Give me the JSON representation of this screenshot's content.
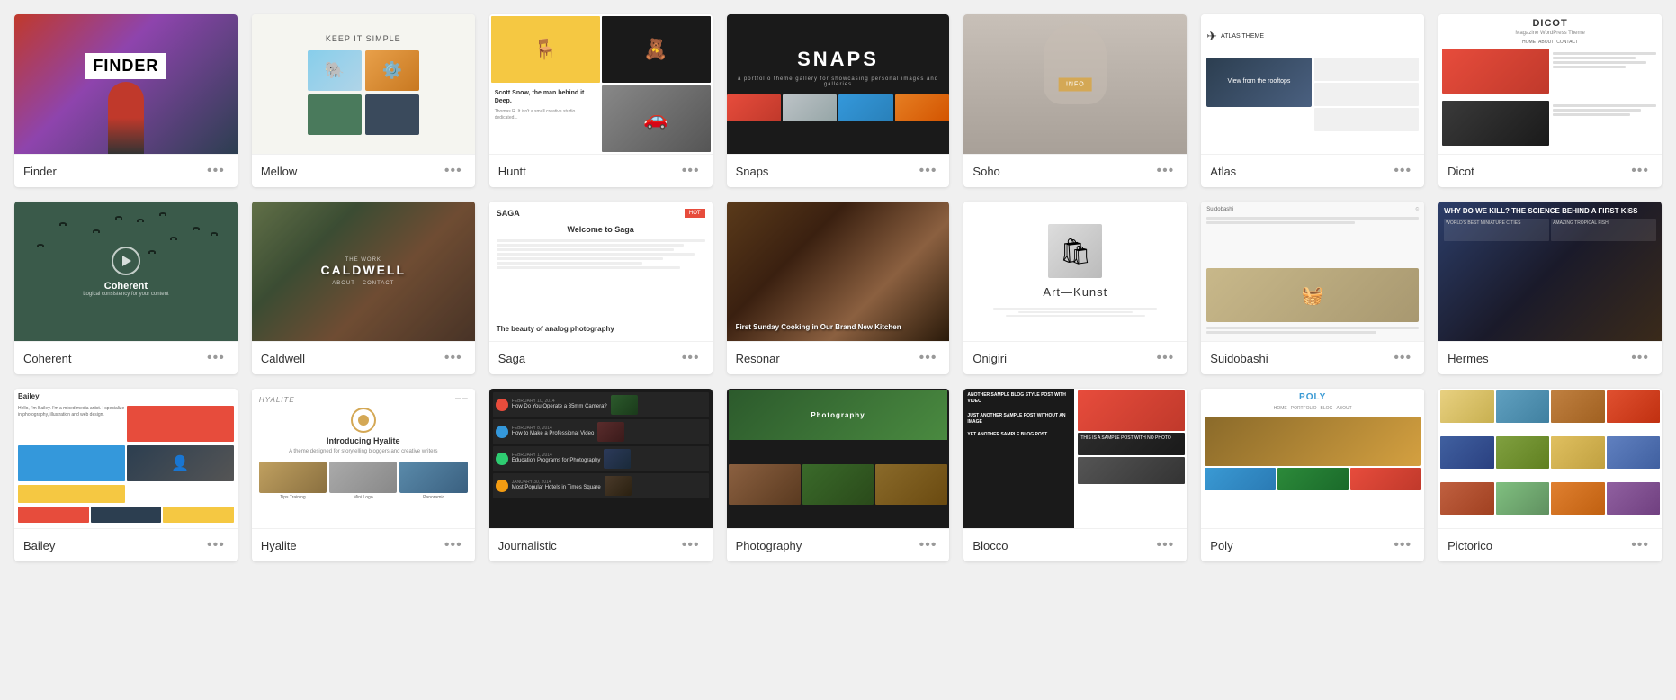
{
  "themes": {
    "row1": [
      {
        "id": "finder",
        "name": "Finder"
      },
      {
        "id": "mellow",
        "name": "Mellow"
      },
      {
        "id": "huntt",
        "name": "Huntt"
      },
      {
        "id": "snaps",
        "name": "Snaps"
      },
      {
        "id": "soho",
        "name": "Soho"
      },
      {
        "id": "atlas",
        "name": "Atlas"
      },
      {
        "id": "dicot",
        "name": "Dicot"
      }
    ],
    "row2": [
      {
        "id": "coherent",
        "name": "Coherent"
      },
      {
        "id": "caldwell",
        "name": "Caldwell"
      },
      {
        "id": "saga",
        "name": "Saga"
      },
      {
        "id": "resonar",
        "name": "Resonar"
      },
      {
        "id": "onigiri",
        "name": "Onigiri"
      },
      {
        "id": "suidobashi",
        "name": "Suidobashi"
      },
      {
        "id": "hermes",
        "name": "Hermes"
      }
    ],
    "row3": [
      {
        "id": "bailey",
        "name": "Bailey"
      },
      {
        "id": "hyalite",
        "name": "Hyalite"
      },
      {
        "id": "journalistic",
        "name": "Journalistic"
      },
      {
        "id": "photography",
        "name": "Photography"
      },
      {
        "id": "blocco",
        "name": "Blocco"
      },
      {
        "id": "poly",
        "name": "Poly"
      },
      {
        "id": "pictorico",
        "name": "Pictorico"
      }
    ]
  },
  "dots_label": "•••",
  "previews": {
    "finder_logo": "FINDER",
    "keep_simple": "KEEP IT SIMPLE",
    "snaps_title": "SNAPS",
    "soho_info": "INFO",
    "atlas_view": "View from the rooftops",
    "dicot_title": "DICOT",
    "dicot_sub": "Magazine WordPress Theme",
    "coherent_text": "Coherent",
    "coherent_sub": "Logical consistency for your content",
    "caldwell_title": "CALDWELL",
    "saga_header": "Welcome to Saga",
    "saga_footer": "The beauty of analog photography",
    "resonar_title": "First Sunday Cooking in Our Brand New Kitchen",
    "onigiri_title": "Art—Kunst",
    "poly_logo": "POLY",
    "photography_title": "Photography"
  }
}
